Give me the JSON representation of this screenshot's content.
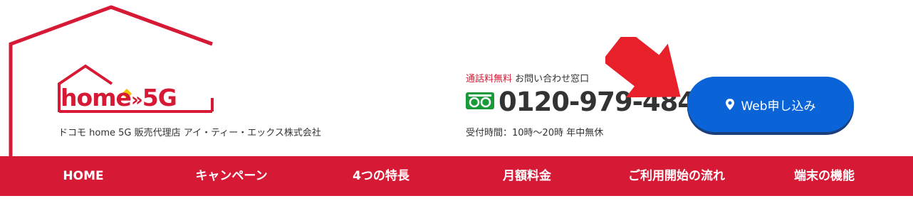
{
  "logo": {
    "text_home": "home",
    "text_chevron": "»",
    "text_5g": "5G"
  },
  "tagline": "ドコモ home 5G 販売代理店 アイ・ティー・エックス株式会社",
  "contact": {
    "free_label": "通話料無料",
    "inquiry_label": "お問い合わせ窓口",
    "phone": "0120-979-484",
    "hours": "受付時間：10時～20時 年中無休",
    "freedial_icon": "freedial-icon"
  },
  "web_button": {
    "label": "Web申し込み",
    "icon": "pin-icon"
  },
  "nav": {
    "items": [
      {
        "label": "HOME"
      },
      {
        "label": "キャンペーン"
      },
      {
        "label": "4つの特長"
      },
      {
        "label": "月額料金"
      },
      {
        "label": "ご利用開始の流れ"
      },
      {
        "label": "端末の機能"
      }
    ]
  },
  "colors": {
    "brand_red": "#d61a35",
    "button_blue": "#0a64d8",
    "arrow_red": "#e8202a"
  }
}
